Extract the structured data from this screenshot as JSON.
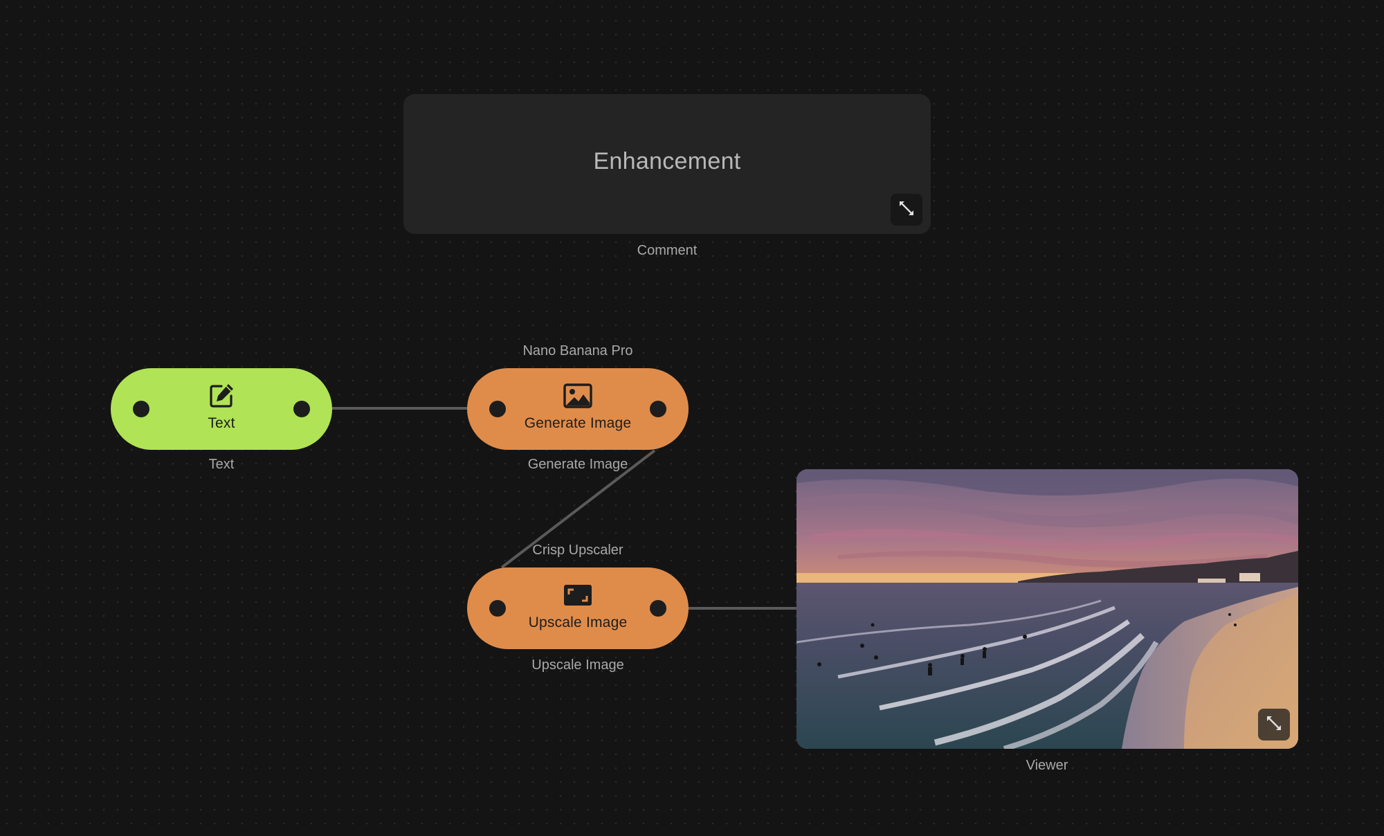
{
  "comment": {
    "text": "Enhancement",
    "caption": "Comment"
  },
  "nodes": {
    "text": {
      "label": "Text",
      "caption_below": "Text",
      "icon": "edit-icon",
      "color": "#b0e355"
    },
    "generate": {
      "label": "Generate Image",
      "caption_above": "Nano Banana Pro",
      "caption_below": "Generate Image",
      "icon": "image-icon",
      "color": "#df8c4b"
    },
    "upscale": {
      "label": "Upscale Image",
      "caption_above": "Crisp Upscaler",
      "caption_below": "Upscale Image",
      "icon": "upscale-icon",
      "color": "#df8c4b"
    }
  },
  "viewer": {
    "caption": "Viewer",
    "image": "beach-sunset-surfers-photo",
    "expand_icon": "expand-icon"
  },
  "colors": {
    "background": "#141414",
    "panel": "#242424",
    "edge": "#5a5a5a",
    "caption": "#a9a9a9"
  }
}
